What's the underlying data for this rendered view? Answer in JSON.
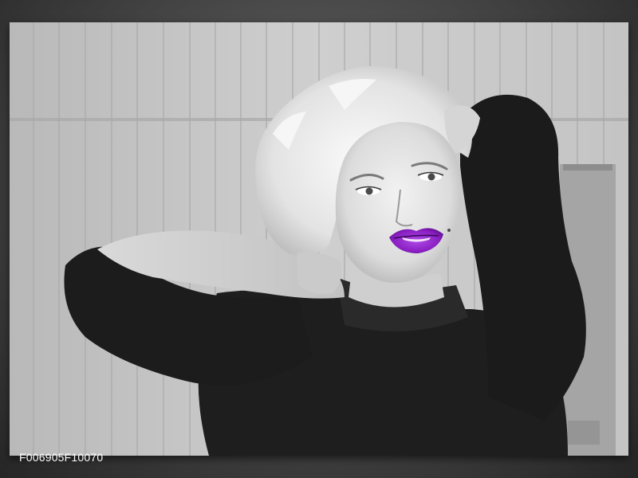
{
  "product": {
    "code": "F006905F10070"
  },
  "artwork": {
    "icon": "portrait-photo-icon",
    "style": "black-and-white with color accent",
    "accent_color": "#8a1fc2",
    "background_tone": "#bdbdbd"
  }
}
